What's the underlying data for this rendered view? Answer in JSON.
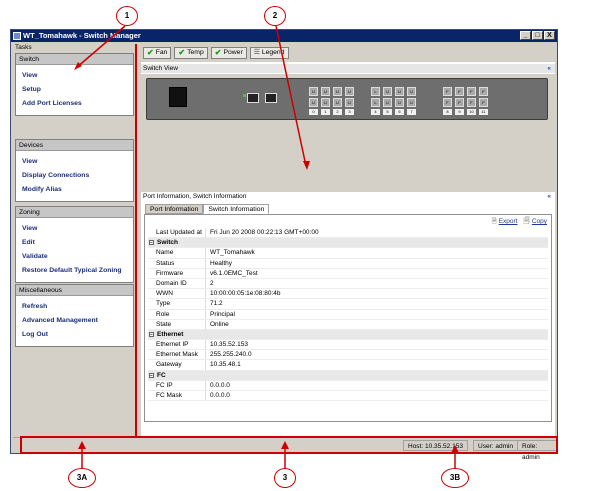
{
  "window": {
    "title": "WT_Tomahawk - Switch Manager"
  },
  "window_buttons": [
    "_",
    "□",
    "X"
  ],
  "tasks_label": "Tasks",
  "groups": [
    {
      "header": "Switch",
      "items": [
        "View",
        "Setup",
        "Add Port Licenses"
      ]
    },
    {
      "header": "Devices",
      "items": [
        "View",
        "Display Connections",
        "Modify Alias"
      ]
    },
    {
      "header": "Zoning",
      "items": [
        "View",
        "Edit",
        "Validate",
        "Restore Default Typical Zoning"
      ]
    },
    {
      "header": "Miscellaneous",
      "items": [
        "Refresh",
        "Advanced Management",
        "Log Out"
      ]
    }
  ],
  "toolbar": {
    "fan": "Fan",
    "temp": "Temp",
    "power": "Power",
    "legend": "Legend"
  },
  "switch_view_label": "Switch View",
  "port_labels_top": [
    "U",
    "U",
    "U",
    "U",
    "L",
    "U",
    "U",
    "U",
    "F",
    "F",
    "F",
    "F"
  ],
  "port_numbers": [
    "0",
    "1",
    "2",
    "3",
    "4",
    "5",
    "6",
    "7",
    "8",
    "9",
    "10",
    "11"
  ],
  "port_info_label": "Port Information, Switch Information",
  "tabs": [
    "Port Information",
    "Switch Information"
  ],
  "export": {
    "export": "Export",
    "copy": "Copy"
  },
  "info_rows": [
    {
      "type": "row",
      "k": "Last Updated at",
      "v": "Fri Jun 20 2008 00:22:13 GMT+00:00"
    },
    {
      "type": "sec",
      "k": "Switch"
    },
    {
      "type": "row",
      "k": "Name",
      "v": "WT_Tomahawk"
    },
    {
      "type": "row",
      "k": "Status",
      "v": "Healthy"
    },
    {
      "type": "row",
      "k": "Firmware",
      "v": "v6.1.0EMC_Test"
    },
    {
      "type": "row",
      "k": "Domain ID",
      "v": "2"
    },
    {
      "type": "row",
      "k": "WWN",
      "v": "10:00:00:05:1e:08:80:4b"
    },
    {
      "type": "row",
      "k": "Type",
      "v": "71.2"
    },
    {
      "type": "row",
      "k": "Role",
      "v": "Principal"
    },
    {
      "type": "row",
      "k": "State",
      "v": "Online"
    },
    {
      "type": "sec",
      "k": "Ethernet"
    },
    {
      "type": "row",
      "k": "Ethernet IP",
      "v": "10.35.52.153"
    },
    {
      "type": "row",
      "k": "Ethernet Mask",
      "v": "255.255.240.0"
    },
    {
      "type": "row",
      "k": "Gateway",
      "v": "10.35.48.1"
    },
    {
      "type": "sec",
      "k": "FC"
    },
    {
      "type": "row",
      "k": "FC IP",
      "v": "0.0.0.0"
    },
    {
      "type": "row",
      "k": "FC Mask",
      "v": "0.0.0.0"
    }
  ],
  "status": {
    "host": "Host: 10.35.52.153",
    "user": "User: admin",
    "role": "Role: admin"
  },
  "callouts": {
    "c1": "1",
    "c2": "2",
    "c3": "3",
    "c3a": "3A",
    "c3b": "3B"
  },
  "colors": {
    "titlebar": "#0a246a",
    "annotation": "#cc0000",
    "link": "#1c2e7a"
  }
}
